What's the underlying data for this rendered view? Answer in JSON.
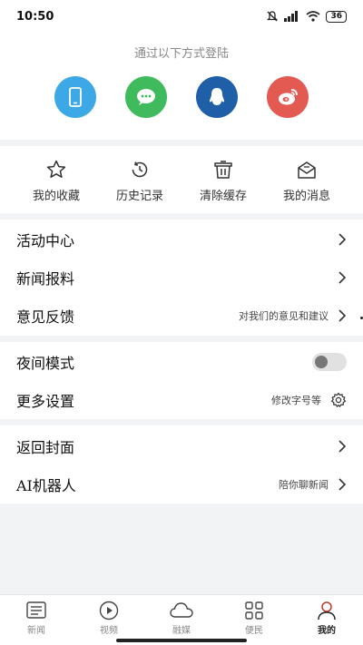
{
  "status": {
    "time": "10:50",
    "battery": "36"
  },
  "login": {
    "label": "通过以下方式登陆",
    "methods": [
      {
        "name": "phone",
        "color": "#3da8e6"
      },
      {
        "name": "wechat",
        "color": "#3fba5c"
      },
      {
        "name": "qq",
        "color": "#1e5fa8"
      },
      {
        "name": "weibo",
        "color": "#e35a52"
      }
    ]
  },
  "quick": [
    {
      "label": "我的收藏",
      "icon": "star-icon"
    },
    {
      "label": "历史记录",
      "icon": "history-icon"
    },
    {
      "label": "清除缓存",
      "icon": "trash-icon"
    },
    {
      "label": "我的消息",
      "icon": "mail-icon"
    }
  ],
  "menu": {
    "activity": "活动中心",
    "report": "新闻报料",
    "feedback": "意见反馈",
    "feedback_hint": "对我们的意见和建议",
    "night": "夜间模式",
    "night_on": false,
    "more": "更多设置",
    "more_hint": "修改字号等",
    "cover": "返回封面",
    "ai": "AI机器人",
    "ai_hint": "陪你聊新闻"
  },
  "tabs": [
    {
      "label": "新闻",
      "icon": "news-icon"
    },
    {
      "label": "视频",
      "icon": "video-icon"
    },
    {
      "label": "融媒",
      "icon": "cloud-icon"
    },
    {
      "label": "便民",
      "icon": "grid-icon"
    },
    {
      "label": "我的",
      "icon": "user-icon",
      "active": true
    }
  ]
}
